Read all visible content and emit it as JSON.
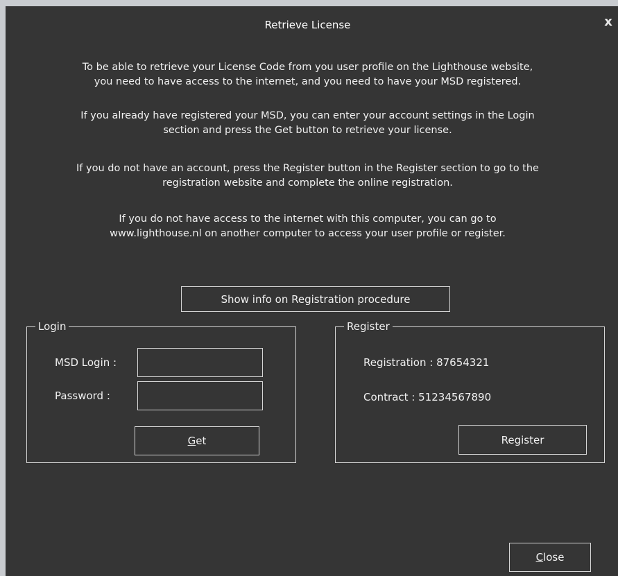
{
  "window": {
    "title": "Retrieve License",
    "close_glyph": "x"
  },
  "intro": {
    "p1_line1": "To be able to retrieve your License Code from you user profile on the Lighthouse website,",
    "p1_line2": "you need to have access to the internet, and you need to have your MSD registered.",
    "p2_line1": "If you already have registered your MSD, you can enter your account settings in the Login",
    "p2_line2": "section and press the Get button to retrieve your license.",
    "p3_line1": "If you do not have an account, press the Register button in the Register section to go to the",
    "p3_line2": "registration website and complete the online registration.",
    "p4_line1": "If you do not have access to the internet with this computer, you can go to",
    "p4_line2": "www.lighthouse.nl on another computer to access your user profile or register."
  },
  "show_info_button": "Show info on Registration procedure",
  "login": {
    "legend": "Login",
    "msd_login_label": "MSD Login :",
    "msd_login_value": "",
    "password_label": "Password :",
    "password_value": "",
    "get_button_mnemonic": "G",
    "get_button_rest": "et"
  },
  "register": {
    "legend": "Register",
    "registration_label": "Registration :",
    "registration_value": "87654321",
    "contract_label": "Contract :",
    "contract_value": "51234567890",
    "register_button": "Register"
  },
  "close_button_mnemonic": "C",
  "close_button_rest": "lose"
}
